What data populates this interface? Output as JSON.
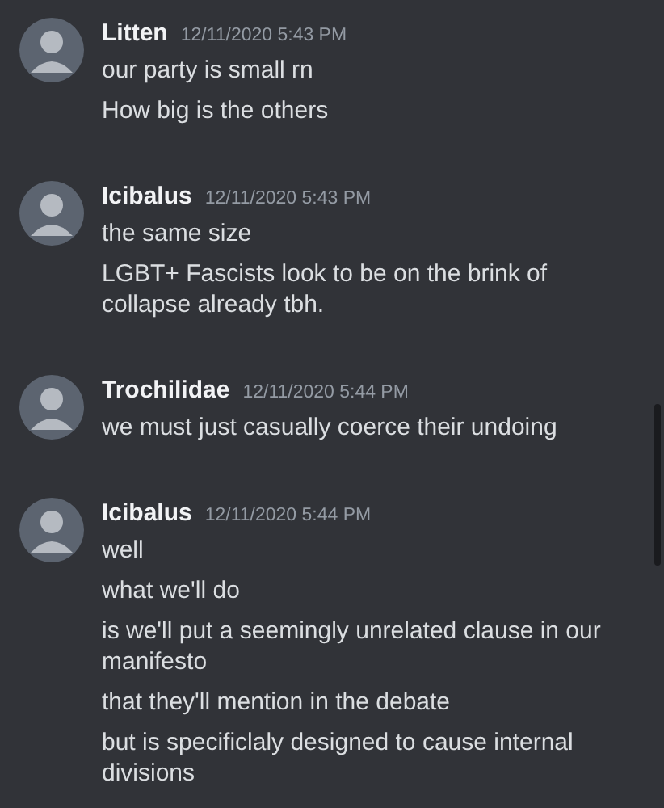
{
  "messages": [
    {
      "author": "Litten",
      "time": "12/11/2020 5:43 PM",
      "lines": [
        "our party is small rn",
        "How big is the others"
      ]
    },
    {
      "author": "Icibalus",
      "time": "12/11/2020 5:43 PM",
      "lines": [
        "the same size",
        "LGBT+ Fascists look to be on the brink of collapse already tbh."
      ]
    },
    {
      "author": "Trochilidae",
      "time": "12/11/2020 5:44 PM",
      "lines": [
        "we must just casually coerce their undoing"
      ]
    },
    {
      "author": "Icibalus",
      "time": "12/11/2020 5:44 PM",
      "lines": [
        "well",
        "what we'll do",
        "is we'll put a seemingly unrelated clause in our manifesto",
        "that they'll mention in the debate",
        "but is specificlaly designed to cause internal divisions"
      ]
    }
  ]
}
